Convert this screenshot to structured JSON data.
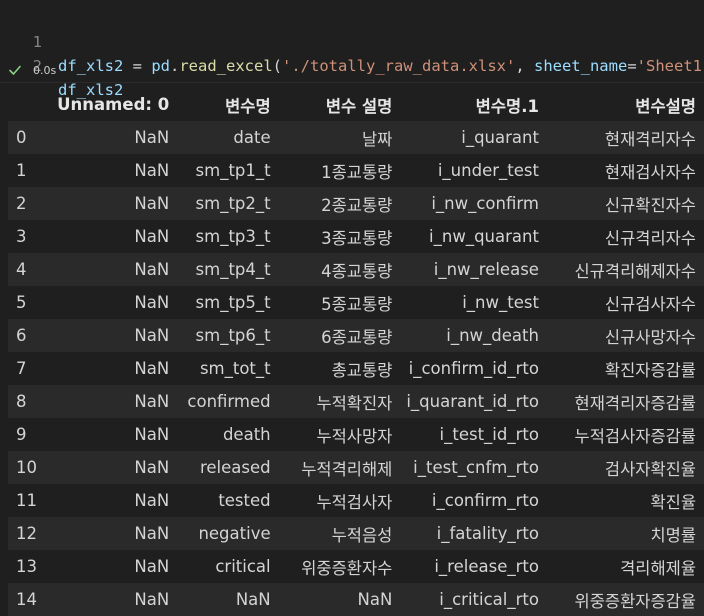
{
  "cell": {
    "line_numbers": [
      "1",
      "2"
    ],
    "line1_tokens": [
      {
        "t": "df_xls2",
        "c": "tok-var"
      },
      {
        "t": " = ",
        "c": "tok-op"
      },
      {
        "t": "pd",
        "c": "tok-var"
      },
      {
        "t": ".",
        "c": "tok-op"
      },
      {
        "t": "read_excel",
        "c": "tok-fn"
      },
      {
        "t": "(",
        "c": "tok-op"
      },
      {
        "t": "'./totally_raw_data.xlsx'",
        "c": "tok-str"
      },
      {
        "t": ", ",
        "c": "tok-op"
      },
      {
        "t": "sheet_name",
        "c": "tok-param"
      },
      {
        "t": "=",
        "c": "tok-op"
      },
      {
        "t": "'Sheet1'",
        "c": "tok-str"
      },
      {
        "t": ")",
        "c": "tok-op"
      }
    ],
    "line2_text": "df_xls2",
    "status": {
      "exec_time": "0.0s",
      "state_icon": "check-icon",
      "success_color": "#89d185"
    }
  },
  "table": {
    "columns": [
      "",
      "Unnamed: 0",
      "변수명",
      "변수 설명",
      "변수명.1",
      "변수설명"
    ],
    "rows": [
      [
        "0",
        "NaN",
        "date",
        "날짜",
        "i_quarant",
        "현재격리자수"
      ],
      [
        "1",
        "NaN",
        "sm_tp1_t",
        "1종교통량",
        "i_under_test",
        "현재검사자수"
      ],
      [
        "2",
        "NaN",
        "sm_tp2_t",
        "2종교통량",
        "i_nw_confirm",
        "신규확진자수"
      ],
      [
        "3",
        "NaN",
        "sm_tp3_t",
        "3종교통량",
        "i_nw_quarant",
        "신규격리자수"
      ],
      [
        "4",
        "NaN",
        "sm_tp4_t",
        "4종교통량",
        "i_nw_release",
        "신규격리해제자수"
      ],
      [
        "5",
        "NaN",
        "sm_tp5_t",
        "5종교통량",
        "i_nw_test",
        "신규검사자수"
      ],
      [
        "6",
        "NaN",
        "sm_tp6_t",
        "6종교통량",
        "i_nw_death",
        "신규사망자수"
      ],
      [
        "7",
        "NaN",
        "sm_tot_t",
        "총교통량",
        "i_confirm_id_rto",
        "확진자증감률"
      ],
      [
        "8",
        "NaN",
        "confirmed",
        "누적확진자",
        "i_quarant_id_rto",
        "현재격리자증감률"
      ],
      [
        "9",
        "NaN",
        "death",
        "누적사망자",
        "i_test_id_rto",
        "누적검사자증감률"
      ],
      [
        "10",
        "NaN",
        "released",
        "누적격리해제",
        "i_test_cnfm_rto",
        "검사자확진율"
      ],
      [
        "11",
        "NaN",
        "tested",
        "누적검사자",
        "i_confirm_rto",
        "확진율"
      ],
      [
        "12",
        "NaN",
        "negative",
        "누적음성",
        "i_fatality_rto",
        "치명률"
      ],
      [
        "13",
        "NaN",
        "critical",
        "위중증환자수",
        "i_release_rto",
        "격리해제율"
      ],
      [
        "14",
        "NaN",
        "NaN",
        "NaN",
        "i_critical_rto",
        "위중증환자증감율"
      ]
    ]
  }
}
